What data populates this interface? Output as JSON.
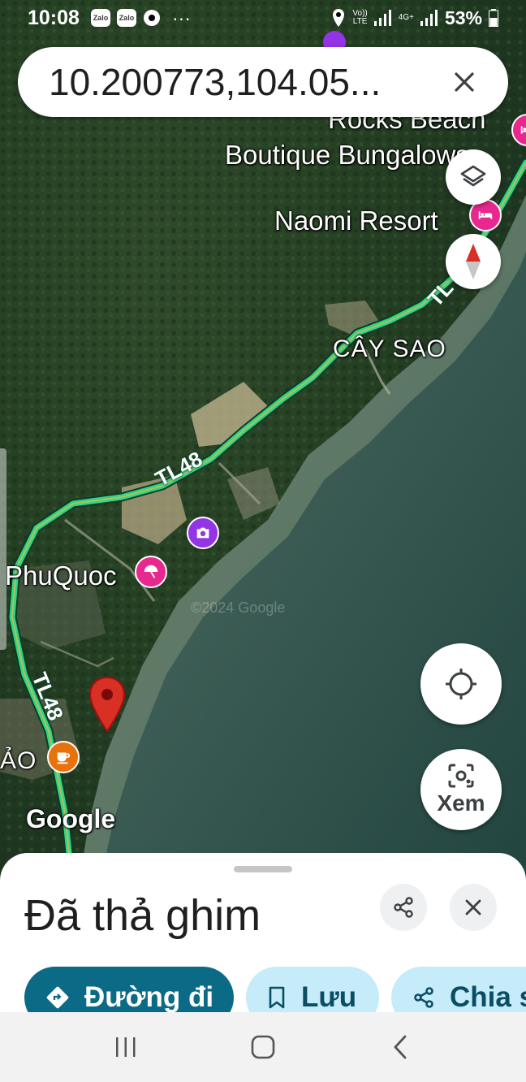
{
  "status_bar": {
    "time": "10:08",
    "apps": [
      "Zalo",
      "Zalo"
    ],
    "more": "···",
    "volte": "Vo))",
    "lte": "LTE",
    "network": "4G+",
    "battery": "53%"
  },
  "search": {
    "value": "10.200773,104.05..."
  },
  "map": {
    "labels": {
      "poi_rocks_beach_line1": "Rocks Beach",
      "poi_rocks_beach_line2": "Boutique Bungalows",
      "poi_naomi": "Naomi Resort",
      "area_cay_sao": "CÂY SAO",
      "poi_phuquoc": "PhuQuoc",
      "area_bao_partial": "ẢO",
      "road_tl48_upper": "TL48",
      "road_tl48_lower": "TL48",
      "road_tl_top": "TL",
      "watermark": "Google",
      "faint_watermark": "©2024 Google"
    },
    "colors": {
      "route": "#2bd68b",
      "dropped_pin": "#d93025",
      "hotel_pin": "#e8288f",
      "camera_pin": "#9334e6",
      "cafe_pin": "#e8710a",
      "beach_pin": "#e8288f"
    },
    "icons": {
      "hotel": "bed-icon",
      "camera": "camera-icon",
      "beach": "umbrella-icon",
      "cafe": "coffee-icon"
    }
  },
  "controls": {
    "layers": "layers-icon",
    "compass": "compass-icon",
    "my_location": "crosshair-icon",
    "lens_label": "Xem"
  },
  "sheet": {
    "title": "Đã thả ghim",
    "actions": {
      "directions": "Đường đi",
      "save": "Lưu",
      "share": "Chia s"
    },
    "colors": {
      "primary_chip": "#0b6a86",
      "secondary_chip": "#c6ecfa"
    }
  },
  "nav": {
    "recent": "recent-apps-icon",
    "home": "home-icon",
    "back": "back-icon"
  }
}
